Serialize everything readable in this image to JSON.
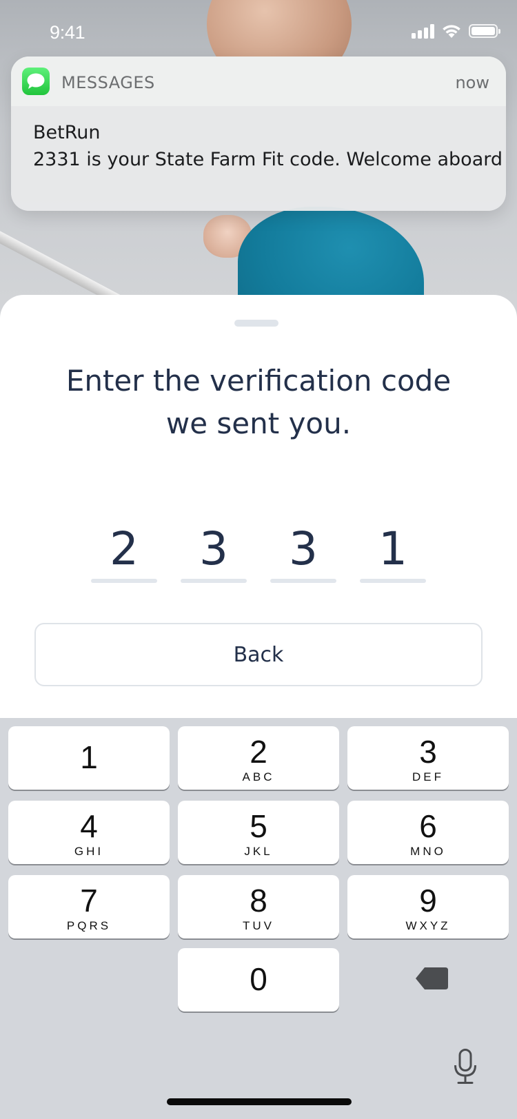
{
  "status_bar": {
    "time": "9:41",
    "signal_bars": 4,
    "battery_level": 1.0,
    "icons": [
      "cellular-signal-icon",
      "wifi-icon",
      "battery-icon"
    ]
  },
  "notification": {
    "app_icon": "messages-app-icon",
    "app_name": "MESSAGES",
    "time": "now",
    "title": "BetRun",
    "message": "2331 is your State Farm Fit code. Welcome aboard"
  },
  "sheet": {
    "title_line1": "Enter the verification code",
    "title_line2": "we sent you.",
    "code_digits": [
      "2",
      "3",
      "3",
      "1"
    ],
    "back_label": "Back"
  },
  "keypad": {
    "keys": [
      {
        "num": "1",
        "letters": ""
      },
      {
        "num": "2",
        "letters": "ABC"
      },
      {
        "num": "3",
        "letters": "DEF"
      },
      {
        "num": "4",
        "letters": "GHI"
      },
      {
        "num": "5",
        "letters": "JKL"
      },
      {
        "num": "6",
        "letters": "MNO"
      },
      {
        "num": "7",
        "letters": "PQRS"
      },
      {
        "num": "8",
        "letters": "TUV"
      },
      {
        "num": "9",
        "letters": "WXYZ"
      },
      {
        "num": "0",
        "letters": ""
      }
    ],
    "delete_icon": "delete-backspace-icon",
    "mic_icon": "microphone-icon"
  },
  "colors": {
    "heading": "#23304a",
    "messages_green": "#21c43c",
    "keypad_bg": "#d3d6db",
    "underline": "#e1e6ec"
  }
}
